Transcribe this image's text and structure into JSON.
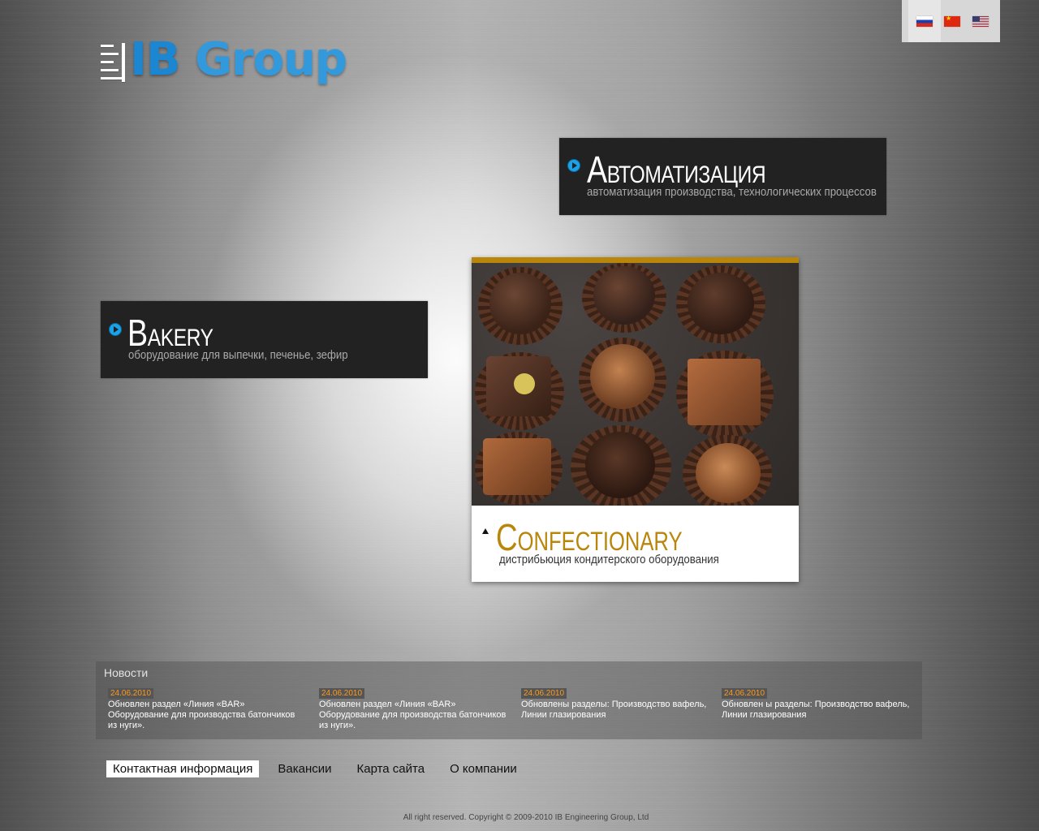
{
  "logo": {
    "ib": "IB",
    "group": "Group"
  },
  "languages": [
    {
      "code": "ru",
      "icon": "flag-russia-icon",
      "active": true
    },
    {
      "code": "cn",
      "icon": "flag-china-icon",
      "active": false
    },
    {
      "code": "us",
      "icon": "flag-usa-icon",
      "active": false
    }
  ],
  "automation": {
    "title_cap": "А",
    "title_rest": "ВТОМАТИЗАЦИЯ",
    "subtitle": "автоматизация производства, технологических процессов"
  },
  "bakery": {
    "title_cap": "B",
    "title_rest": "AKERY",
    "subtitle": "оборудование для выпечки, печенье, зефир"
  },
  "confectionary": {
    "title_cap": "C",
    "title_rest": "ONFECTIONARY",
    "subtitle": "дистрибьюция кондитерского оборудования",
    "accent_color": "#b8860b"
  },
  "news": {
    "heading": "Новости",
    "items": [
      {
        "date": "24.06.2010",
        "text": "Обновлен раздел «Линия «BAR» Оборудование для производства батончиков из нуги»."
      },
      {
        "date": "24.06.2010",
        "text": "Обновлен раздел «Линия «BAR» Оборудование для производства батончиков из нуги»."
      },
      {
        "date": "24.06.2010",
        "text": "Обновлены разделы: Производство вафель, Линии глазирования"
      },
      {
        "date": "24.06.2010",
        "text": "Обновлен ы разделы: Производство вафель, Линии глазирования"
      }
    ]
  },
  "footer_nav": [
    {
      "label": "Контактная информация",
      "active": true
    },
    {
      "label": "Вакансии",
      "active": false
    },
    {
      "label": "Карта сайта",
      "active": false
    },
    {
      "label": "О компании",
      "active": false
    }
  ],
  "copyright": "All right reserved. Copyright © 2009-2010 IB Engineering Group, Ltd"
}
